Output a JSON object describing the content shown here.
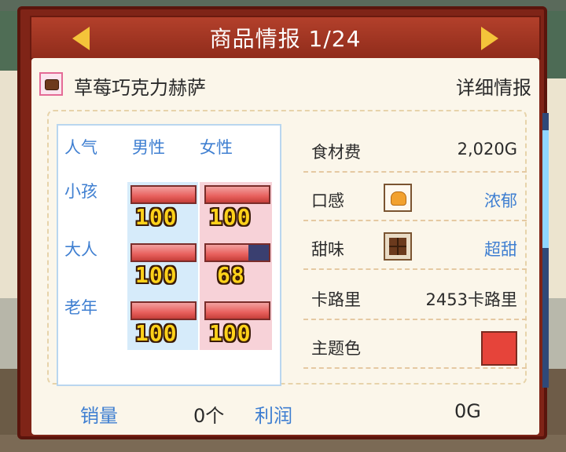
{
  "header": {
    "title": "商品情报",
    "page": "1/24"
  },
  "product": {
    "name": "草莓巧克力赫萨",
    "detail_link": "详细情报"
  },
  "popularity": {
    "header_label": "人气",
    "columns": [
      "男性",
      "女性"
    ],
    "rows": [
      {
        "label": "小孩",
        "male": 100,
        "female": 100
      },
      {
        "label": "大人",
        "male": 100,
        "female": 68
      },
      {
        "label": "老年",
        "male": 100,
        "female": 100
      }
    ]
  },
  "attributes": {
    "ingredient_cost": {
      "label": "食材费",
      "value": "2,020G"
    },
    "texture": {
      "label": "口感",
      "value": "浓郁",
      "icon": "pudding-icon"
    },
    "sweetness": {
      "label": "甜味",
      "value": "超甜",
      "icon": "chocolate-icon"
    },
    "calories": {
      "label": "卡路里",
      "value": "2453卡路里"
    },
    "theme_color": {
      "label": "主题色",
      "color": "#e6443a"
    }
  },
  "footer": {
    "sales_label": "销量",
    "sales_value": "0个",
    "profit_label": "利润",
    "profit_value": "0G"
  }
}
